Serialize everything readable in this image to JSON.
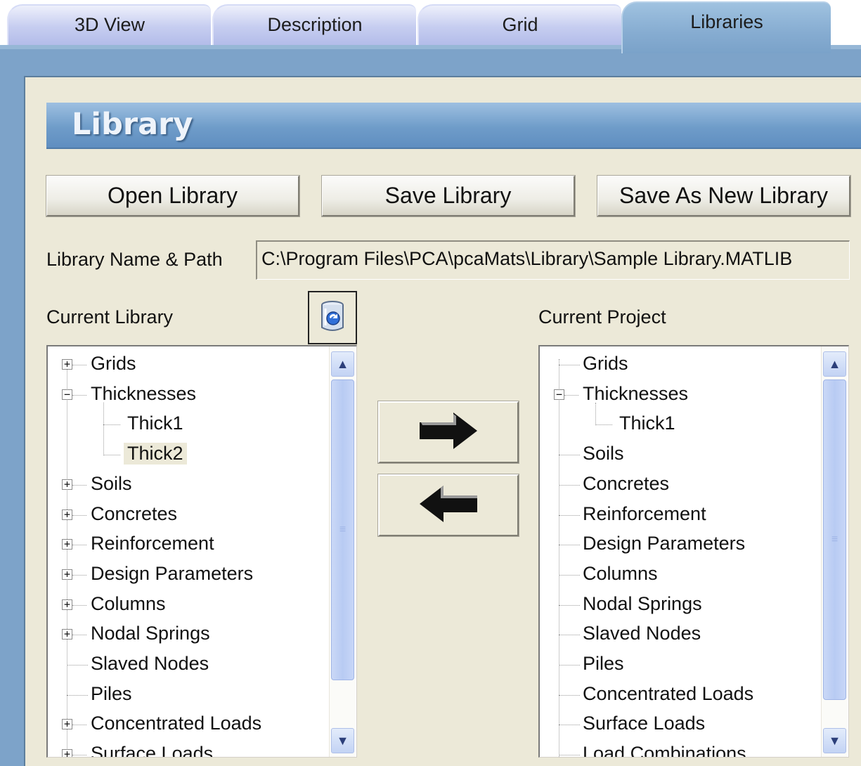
{
  "tabs": [
    {
      "label": "3D View"
    },
    {
      "label": "Description"
    },
    {
      "label": "Grid"
    },
    {
      "label": "Libraries"
    }
  ],
  "library": {
    "title": "Library",
    "buttons": {
      "open": "Open Library",
      "save": "Save Library",
      "save_as": "Save As New Library"
    },
    "path_label": "Library Name & Path",
    "path_value": "C:\\Program Files\\PCA\\pcaMats\\Library\\Sample Library.MATLIB",
    "current_library_label": "Current Library",
    "current_project_label": "Current Project"
  },
  "current_library_tree": [
    {
      "label": "Grids",
      "expander": "+"
    },
    {
      "label": "Thicknesses",
      "expander": "-"
    },
    {
      "label": "Thick1",
      "child": true
    },
    {
      "label": "Thick2",
      "child": true,
      "selected": true
    },
    {
      "label": "Soils",
      "expander": "+"
    },
    {
      "label": "Concretes",
      "expander": "+"
    },
    {
      "label": "Reinforcement",
      "expander": "+"
    },
    {
      "label": "Design Parameters",
      "expander": "+"
    },
    {
      "label": "Columns",
      "expander": "+"
    },
    {
      "label": "Nodal Springs",
      "expander": "+"
    },
    {
      "label": "Slaved Nodes"
    },
    {
      "label": "Piles"
    },
    {
      "label": "Concentrated Loads",
      "expander": "+"
    },
    {
      "label": "Surface Loads",
      "expander": "+"
    }
  ],
  "current_project_tree": [
    {
      "label": "Grids"
    },
    {
      "label": "Thicknesses",
      "expander": "-"
    },
    {
      "label": "Thick1",
      "child": true
    },
    {
      "label": "Soils"
    },
    {
      "label": "Concretes"
    },
    {
      "label": "Reinforcement"
    },
    {
      "label": "Design Parameters"
    },
    {
      "label": "Columns"
    },
    {
      "label": "Nodal Springs"
    },
    {
      "label": "Slaved Nodes"
    },
    {
      "label": "Piles"
    },
    {
      "label": "Concentrated Loads"
    },
    {
      "label": "Surface Loads"
    },
    {
      "label": "Load Combinations"
    }
  ],
  "colors": {
    "frame": "#7da3c9",
    "panel": "#ece9d8",
    "tab_inactive": "#c6cdf0",
    "tab_active": "#86acd1"
  },
  "icons": {
    "refresh": "refresh-library-icon",
    "copy_to_project": "arrow-right-icon",
    "copy_to_library": "arrow-left-icon"
  }
}
